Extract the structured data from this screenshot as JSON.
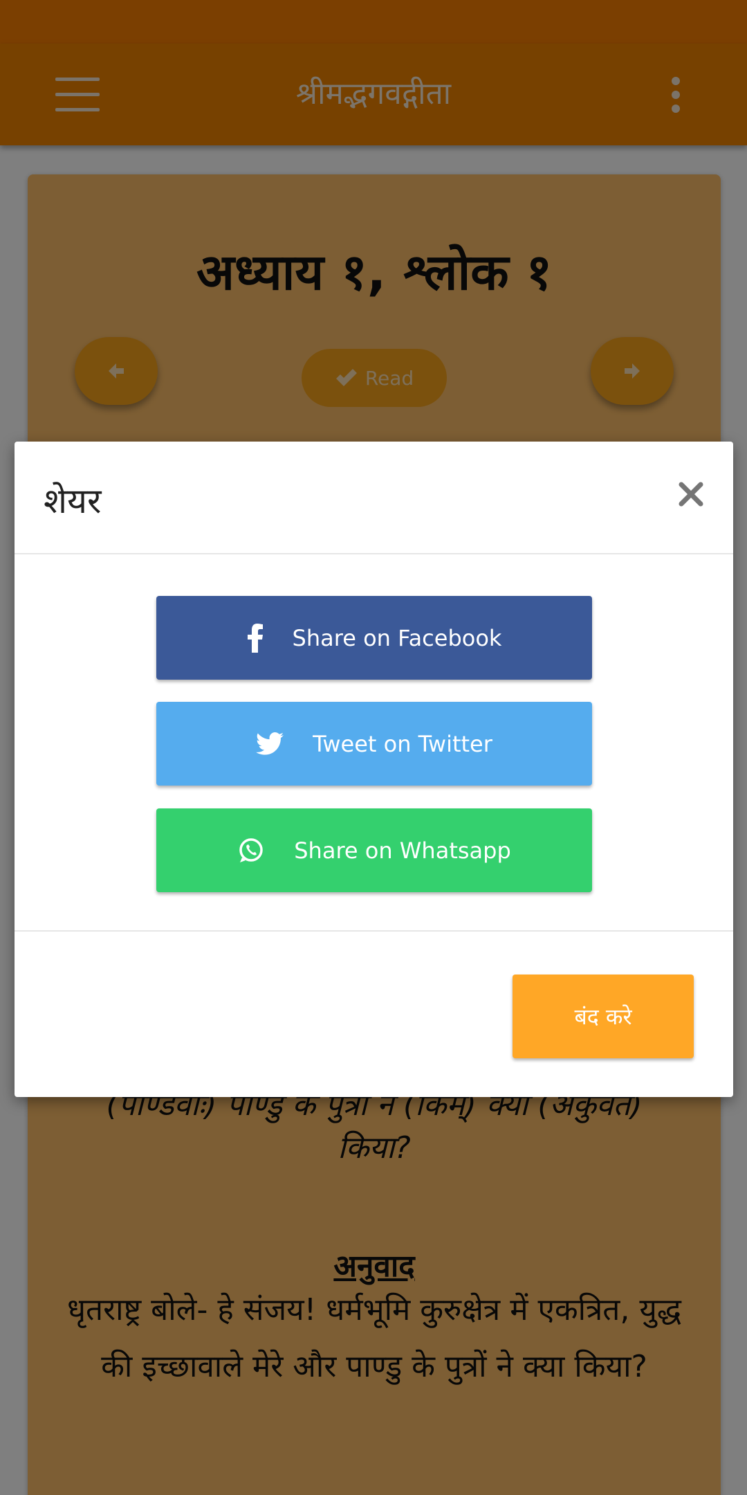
{
  "app_bar": {
    "title": "श्रीमद्भगवद्गीता"
  },
  "verse_card": {
    "heading": "अध्याय १, श्लोक १",
    "read_label": "Read",
    "meaning_tail_clipped": "(पाण्डवाः) पाण्डु के पुत्रों ने (किम्) क्या (अकुर्वत)",
    "meaning_tail_last": "किया?",
    "translation_title": "अनुवाद",
    "translation_text": "धृतराष्ट्र बोले- हे संजय! धर्मभूमि कुरुक्षेत्र में एकत्रित, युद्ध की इच्छावाले मेरे और पाण्डु के पुत्रों ने क्या किया?"
  },
  "share_modal": {
    "title": "शेयर",
    "buttons": [
      {
        "label": "Share on Facebook",
        "icon": "facebook-icon",
        "color": "#3b5998"
      },
      {
        "label": "Tweet on Twitter",
        "icon": "twitter-icon",
        "color": "#55acee"
      },
      {
        "label": "Share on Whatsapp",
        "icon": "whatsapp-icon",
        "color": "#34d06e"
      }
    ],
    "close_label": "बंद करे"
  },
  "colors": {
    "status_bar": "#f77e03",
    "app_bar": "#ef8300",
    "card": "#fbbd68",
    "accent": "#ffa726"
  }
}
